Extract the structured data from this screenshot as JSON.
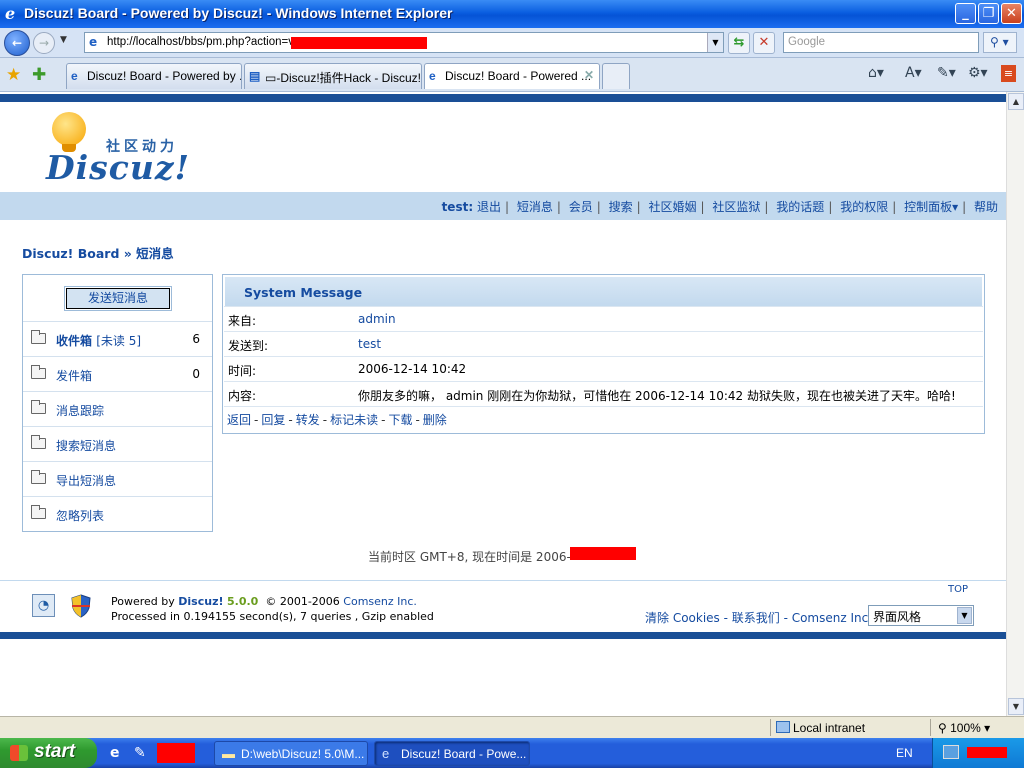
{
  "window": {
    "title": "Discuz! Board - Powered by Discuz! - Windows Internet Explorer",
    "minimize": "_",
    "maximize": "❐",
    "close": "✕"
  },
  "address_bar": {
    "url": "http://localhost/bbs/pm.php?action=v",
    "search_placeholder": "Google"
  },
  "tabs": [
    {
      "label": "Discuz! Board - Powered by ..."
    },
    {
      "label": "▭-Discuz!插件Hack - Discuz! ..."
    },
    {
      "label": "Discuz! Board - Powered ...",
      "active": true
    }
  ],
  "logo": {
    "tagline": "社区动力",
    "brand": "Discuz!"
  },
  "menu": {
    "user": "test:",
    "items": [
      "退出",
      "短消息",
      "会员",
      "搜索",
      "社区婚姻",
      "社区监狱",
      "我的话题",
      "我的权限",
      "控制面板▾",
      "帮助"
    ]
  },
  "breadcrumb": "Discuz! Board » 短消息",
  "left_panel": {
    "send_button": "发送短消息",
    "items": [
      {
        "label": "收件箱",
        "unread": "[未读 5]",
        "count": "6"
      },
      {
        "label": "发件箱",
        "count": "0"
      },
      {
        "label": "消息跟踪"
      },
      {
        "label": "搜索短消息"
      },
      {
        "label": "导出短消息"
      },
      {
        "label": "忽略列表"
      }
    ]
  },
  "message": {
    "header": "System Message",
    "from_label": "来自:",
    "from": "admin",
    "to_label": "发送到:",
    "to": "test",
    "time_label": "时间:",
    "time": "2006-12-14 10:42",
    "content_label": "内容:",
    "content": "你朋友多的嘛， admin 刚刚在为你劫狱，可惜他在 2006-12-14 10:42 劫狱失败，现在也被关进了天牢。哈哈!",
    "actions": [
      "返回",
      "回复",
      "转发",
      "标记未读",
      "下载",
      "删除"
    ]
  },
  "timezone_text": "当前时区 GMT+8, 现在时间是 2006-",
  "footer": {
    "top_link": "TOP",
    "powered_prefix": "Powered by",
    "brand": "Discuz!",
    "version": "5.0.0",
    "copyright": "© 2001-2006",
    "company": "Comsenz Inc.",
    "processed": "Processed in 0.194155 second(s), 7 queries , Gzip enabled",
    "links": "清除 Cookies - 联系我们 - Comsenz Inc.",
    "style_select": "界面风格"
  },
  "status_bar": {
    "zone": "Local intranet",
    "zoom": "100%"
  },
  "taskbar": {
    "start": "start",
    "tasks": [
      {
        "label": "D:\\web\\Discuz! 5.0\\M..."
      },
      {
        "label": "Discuz! Board - Powe...",
        "active": true
      }
    ],
    "lang": "EN"
  },
  "colors": {
    "link": "#154ba0",
    "nav_bg": "#c2d9ee",
    "border": "#9dbbd9",
    "dark_bar": "#1a4f96",
    "redaction": "#ff0000"
  }
}
